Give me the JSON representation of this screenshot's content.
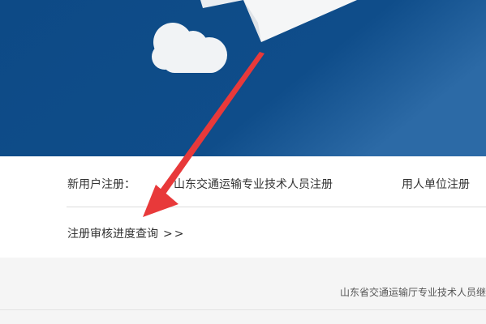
{
  "registration": {
    "label": "新用户注册：",
    "personal_link": "山东交通运输专业技术人员注册",
    "employer_link": "用人单位注册"
  },
  "review": {
    "query_link": "注册审核进度查询",
    "arrows": ">>"
  },
  "footer": {
    "text": "山东省交通运输厅专业技术人员继"
  },
  "colors": {
    "hero_bg": "#0e4b85",
    "annotation_arrow": "#e8393a",
    "footer_bg": "#f5f5f5"
  },
  "icons": {
    "cloud": "cloud-icon",
    "paper_plane": "paper-plane-icon",
    "arrow": "red-arrow-annotation"
  }
}
